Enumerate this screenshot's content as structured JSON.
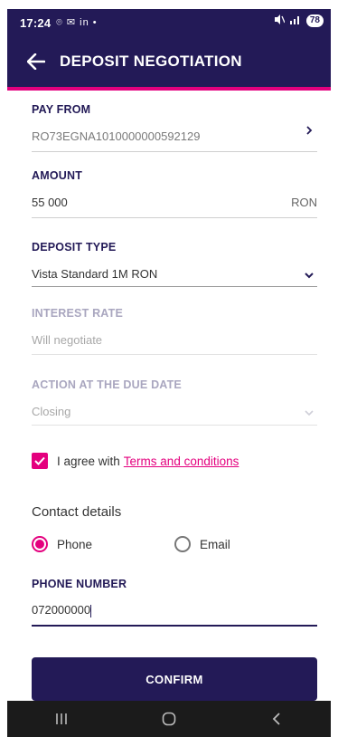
{
  "status_bar": {
    "time": "17:24",
    "left_icons": "⌾ ✉ in •",
    "battery": "78"
  },
  "header": {
    "title": "DEPOSIT NEGOTIATION"
  },
  "form": {
    "pay_from": {
      "label": "PAY FROM",
      "value": "RO73EGNA1010000000592129"
    },
    "amount": {
      "label": "AMOUNT",
      "value": "55 000",
      "currency": "RON"
    },
    "deposit_type": {
      "label": "DEPOSIT TYPE",
      "value": "Vista Standard 1M RON"
    },
    "interest_rate": {
      "label": "INTEREST RATE",
      "value": "Will negotiate"
    },
    "action_due": {
      "label": "ACTION AT THE DUE DATE",
      "value": "Closing"
    }
  },
  "agree": {
    "text": "I agree with",
    "link": "Terms and conditions",
    "checked": true
  },
  "contact": {
    "title": "Contact details",
    "options": [
      {
        "label": "Phone",
        "selected": true
      },
      {
        "label": "Email",
        "selected": false
      }
    ]
  },
  "phone": {
    "label": "PHONE NUMBER",
    "value": "072000000"
  },
  "confirm_label": "CONFIRM",
  "colors": {
    "brand": "#231a57",
    "accent": "#e4007e"
  }
}
